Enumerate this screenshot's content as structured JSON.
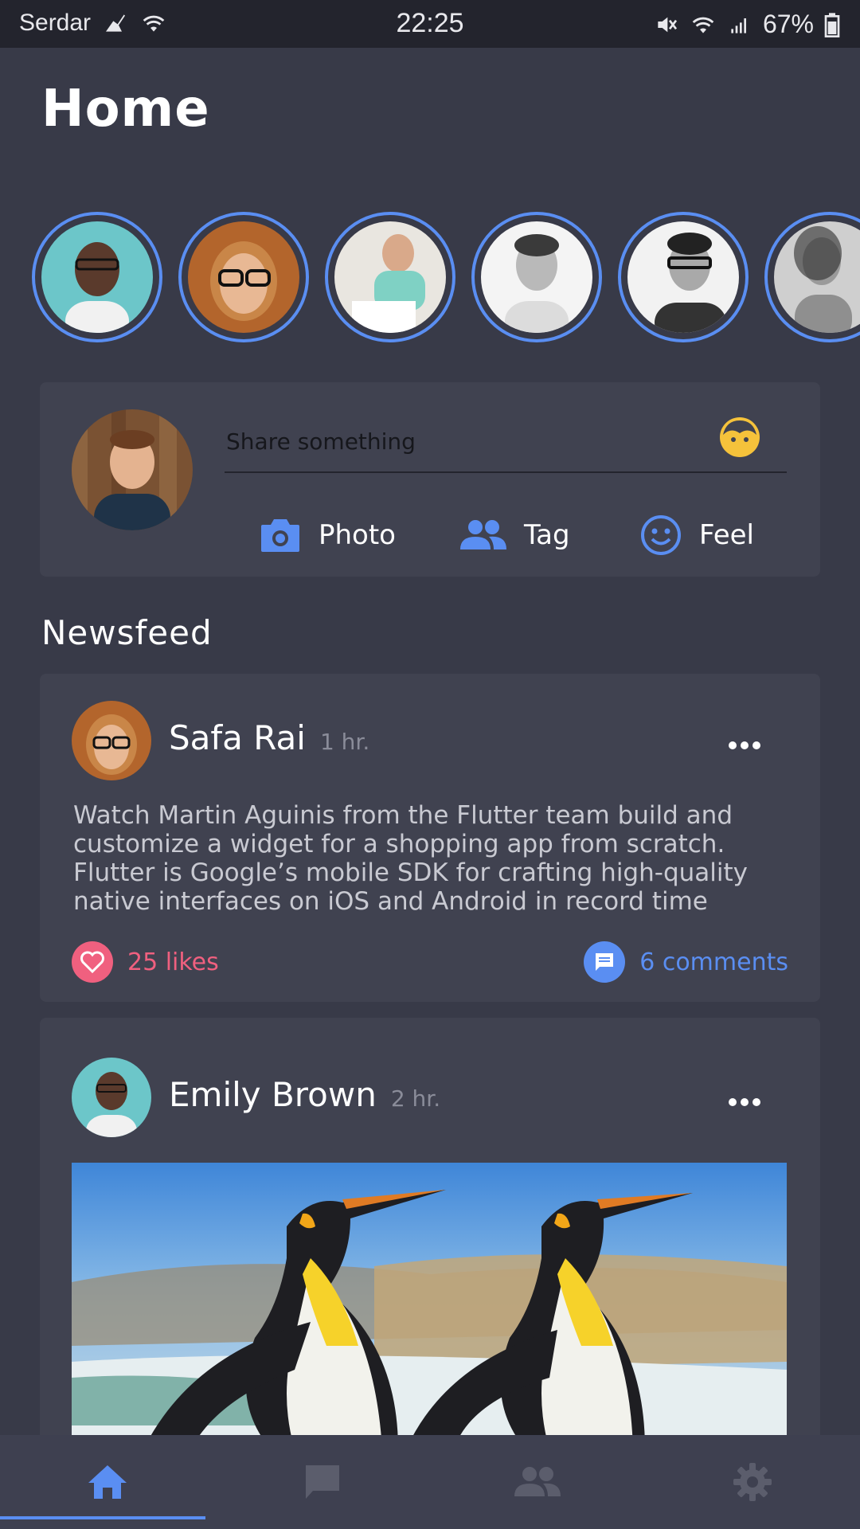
{
  "status_bar": {
    "carrier": "Serdar",
    "time": "22:25",
    "battery": "67%"
  },
  "page": {
    "title": "Home"
  },
  "stories": [
    {
      "name": "story-1"
    },
    {
      "name": "story-2"
    },
    {
      "name": "story-3"
    },
    {
      "name": "story-4"
    },
    {
      "name": "story-5"
    },
    {
      "name": "story-6"
    }
  ],
  "composer": {
    "placeholder": "Share something",
    "actions": {
      "photo": "Photo",
      "tag": "Tag",
      "feel": "Feel"
    }
  },
  "newsfeed": {
    "title": "Newsfeed",
    "posts": [
      {
        "author": "Safa Rai",
        "time": "1 hr.",
        "text": "Watch Martin Aguinis from the Flutter team build and customize a widget for a shopping app from scratch. Flutter is Google’s mobile SDK for crafting high-quality native interfaces on iOS and Android in record time",
        "likes": "25 likes",
        "comments": "6 comments"
      },
      {
        "author": "Emily Brown",
        "time": "2 hr."
      }
    ]
  },
  "bottom_nav": {
    "items": [
      "home-icon",
      "chat-icon",
      "people-icon",
      "settings-icon"
    ],
    "active": "home-icon"
  },
  "colors": {
    "background": "#383a48",
    "card": "#404250",
    "accent": "#5a8ef2",
    "like": "#f0607f",
    "emoji": "#f5c23b"
  }
}
